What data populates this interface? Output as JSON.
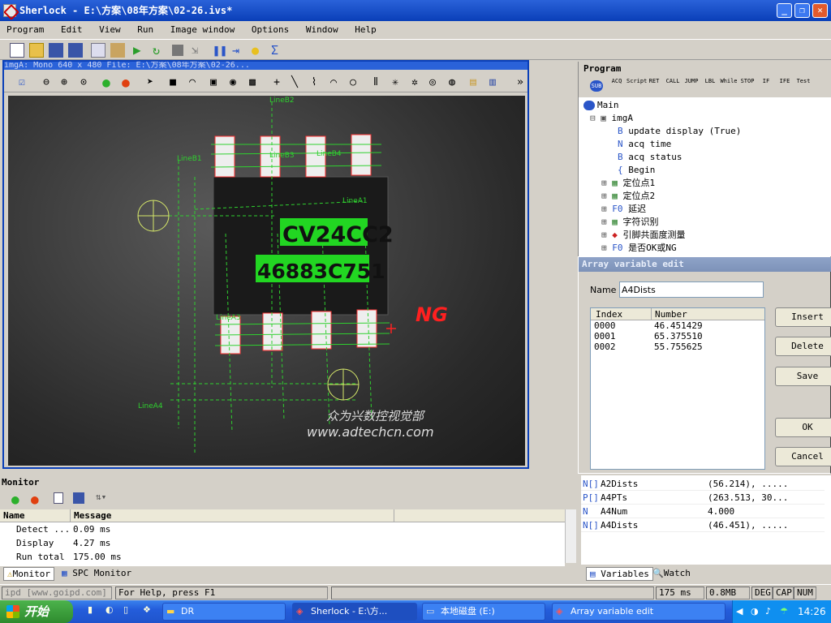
{
  "app": {
    "title": "Sherlock - E:\\方案\\08年方案\\02-26.ivs*"
  },
  "menu": [
    "Program",
    "Edit",
    "View",
    "Run",
    "Image window",
    "Options",
    "Window",
    "Help"
  ],
  "image_window": {
    "title": "imgA: Mono 640 x 480   File: E:\\方案\\08年方案\\02-26...",
    "overlay": {
      "line_labels": [
        "LineB2",
        "LineB1",
        "LineB3",
        "LineB4",
        "LineA1",
        "LineA3",
        "LineA4"
      ],
      "ocr_line1": "CV24CC2",
      "ocr_line2": "46883C751",
      "result": "NG",
      "watermark_cn": "众为兴数控视觉部",
      "watermark_url": "www.adtechcn.com"
    }
  },
  "program": {
    "title": "Program",
    "toolbar": [
      "SUB",
      "ACQ",
      "Script",
      "RET",
      "CALL",
      "JUMP",
      "LBL",
      "While",
      "STOP",
      "IF",
      "IFE",
      "Test"
    ],
    "tree": [
      {
        "label": "Main",
        "indent": 0
      },
      {
        "label": "imgA",
        "indent": 1
      },
      {
        "label": "update display (True)",
        "indent": 2,
        "prefix": "B"
      },
      {
        "label": "acq time",
        "indent": 2,
        "prefix": "N"
      },
      {
        "label": "acq status",
        "indent": 2,
        "prefix": "B"
      },
      {
        "label": "Begin",
        "indent": 2,
        "prefix": "{"
      },
      {
        "label": "定位点1",
        "indent": 1
      },
      {
        "label": "定位点2",
        "indent": 1
      },
      {
        "label": "延迟",
        "indent": 1,
        "prefix": "F0"
      },
      {
        "label": "字符识别",
        "indent": 1
      },
      {
        "label": "引脚共面度测量",
        "indent": 1
      },
      {
        "label": "是否OK或NG",
        "indent": 1,
        "prefix": "F0"
      }
    ]
  },
  "dialog": {
    "title": "Array variable edit",
    "name_label": "Name",
    "name_value": "A4Dists",
    "columns": [
      "Index",
      "Number"
    ],
    "rows": [
      {
        "index": "0000",
        "number": "46.451429"
      },
      {
        "index": "0001",
        "number": "65.375510"
      },
      {
        "index": "0002",
        "number": "55.755625"
      }
    ],
    "buttons": {
      "insert": "Insert",
      "delete": "Delete",
      "save": "Save",
      "ok": "OK",
      "cancel": "Cancel"
    }
  },
  "variables": [
    {
      "type": "N[]",
      "name": "A2Dists",
      "value": "(56.214), ....."
    },
    {
      "type": "P[]",
      "name": "A4PTs",
      "value": "(263.513, 30..."
    },
    {
      "type": "N",
      "name": "A4Num",
      "value": "4.000"
    },
    {
      "type": "N[]",
      "name": "A4Dists",
      "value": "(46.451), ....."
    }
  ],
  "var_tabs": [
    "Variables",
    "Watch"
  ],
  "monitor": {
    "title": "Monitor",
    "columns": [
      "Name",
      "Message"
    ],
    "rows": [
      {
        "name": "Detect ...",
        "message": "0.09 ms"
      },
      {
        "name": "Display",
        "message": "4.27 ms"
      },
      {
        "name": "Run total",
        "message": "175.00 ms"
      }
    ],
    "tabs": [
      "Monitor",
      "SPC Monitor"
    ]
  },
  "status": {
    "left": "ipd [www.goipd.com]",
    "help": "For Help, press F1",
    "time": "175 ms",
    "mem": "0.8MB",
    "deg": "DEG",
    "cap": "CAP",
    "num": "NUM"
  },
  "taskbar": {
    "start": "开始",
    "tasks": [
      "DR",
      "Sherlock - E:\\方...",
      "本地磁盘 (E:)",
      "Array variable edit"
    ],
    "clock": "14:26"
  }
}
